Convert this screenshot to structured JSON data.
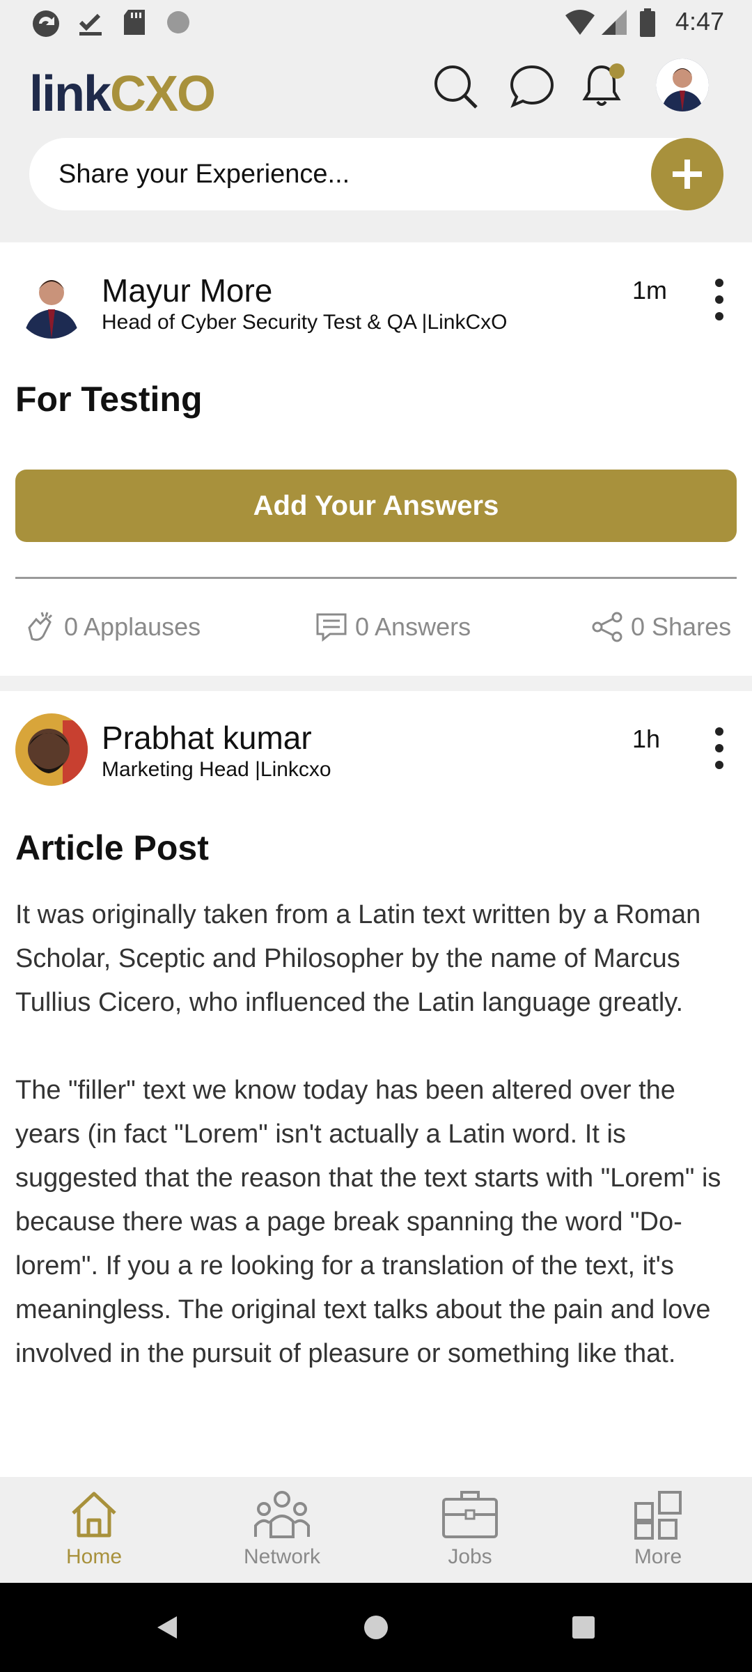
{
  "status_bar": {
    "time": "4:47",
    "icons": [
      "sync-icon",
      "download-done-icon",
      "sd-card-icon",
      "circle-icon",
      "wifi-icon",
      "signal-icon",
      "battery-icon"
    ]
  },
  "header": {
    "logo": {
      "part1": "link",
      "part2": "CXO"
    },
    "share_placeholder": "Share your Experience...",
    "icons": [
      "search-icon",
      "chat-icon",
      "bell-icon",
      "profile-avatar"
    ]
  },
  "posts": [
    {
      "author": "Mayur More",
      "role": "Head of Cyber Security Test & QA |LinkCxO",
      "time": "1m",
      "heading": "For Testing",
      "cta": "Add Your Answers",
      "stats": {
        "applauses": "0 Applauses",
        "answers": "0 Answers",
        "shares": "0 Shares"
      }
    },
    {
      "author": "Prabhat kumar",
      "role": "Marketing Head |Linkcxo",
      "time": "1h",
      "heading": "Article Post",
      "body": "It was originally taken from a Latin text written by a Roman Scholar, Sceptic and Philosopher by the name of Marcus Tullius Cicero, who influenced the Latin language greatly.\n\nThe \"filler\" text we know today has been altered over the years (in fact \"Lorem\" isn't actually a Latin word. It is suggested that the reason that the text starts with \"Lorem\" is because there was a page break spanning the word \"Do-lorem\". If you a re looking for a translation of the text, it's meaningless. The original text talks about the pain and love involved in the pursuit of pleasure or something like that."
    }
  ],
  "bottom_nav": [
    {
      "label": "Home",
      "icon": "home-icon",
      "active": true
    },
    {
      "label": "Network",
      "icon": "network-icon",
      "active": false
    },
    {
      "label": "Jobs",
      "icon": "briefcase-icon",
      "active": false
    },
    {
      "label": "More",
      "icon": "grid-icon",
      "active": false
    }
  ],
  "colors": {
    "accent": "#a8913c",
    "brand_dark": "#1f2a4a",
    "muted": "#8a8a8a"
  }
}
